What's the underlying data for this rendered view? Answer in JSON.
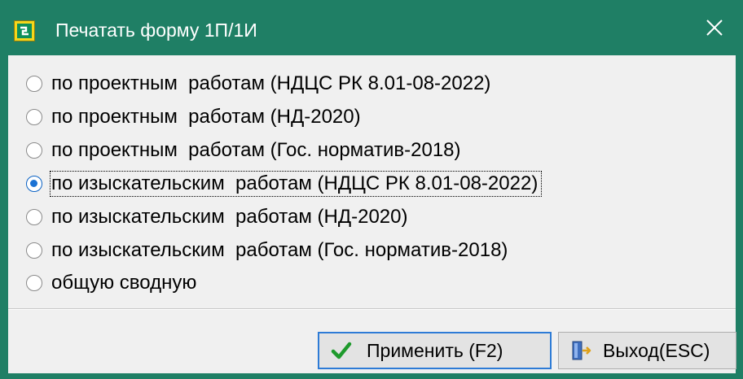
{
  "window": {
    "title": "Печатать форму 1П/1И",
    "close_label": "✕"
  },
  "options": [
    {
      "label": "по проектным  работам (НДЦС РК 8.01-08-2022)",
      "checked": false
    },
    {
      "label": "по проектным  работам (НД-2020)",
      "checked": false
    },
    {
      "label": "по проектным  работам (Гос. норматив-2018)",
      "checked": false
    },
    {
      "label": "по изыскательским  работам (НДЦС РК 8.01-08-2022)",
      "checked": true
    },
    {
      "label": "по изыскательским  работам (НД-2020)",
      "checked": false
    },
    {
      "label": "по изыскательским  работам (Гос. норматив-2018)",
      "checked": false
    },
    {
      "label": "общую сводную",
      "checked": false
    }
  ],
  "buttons": {
    "apply_label": "Применить (F2)",
    "exit_label": "Выход(ESC)"
  },
  "icons": {
    "app": "app-icon",
    "apply": "checkmark-icon",
    "exit": "exit-door-icon",
    "close": "close-icon"
  },
  "colors": {
    "titlebar": "#1f7f65",
    "client": "#f0f0f0",
    "radio_selected": "#1a72d4",
    "default_button_border": "#2d7bd6"
  }
}
